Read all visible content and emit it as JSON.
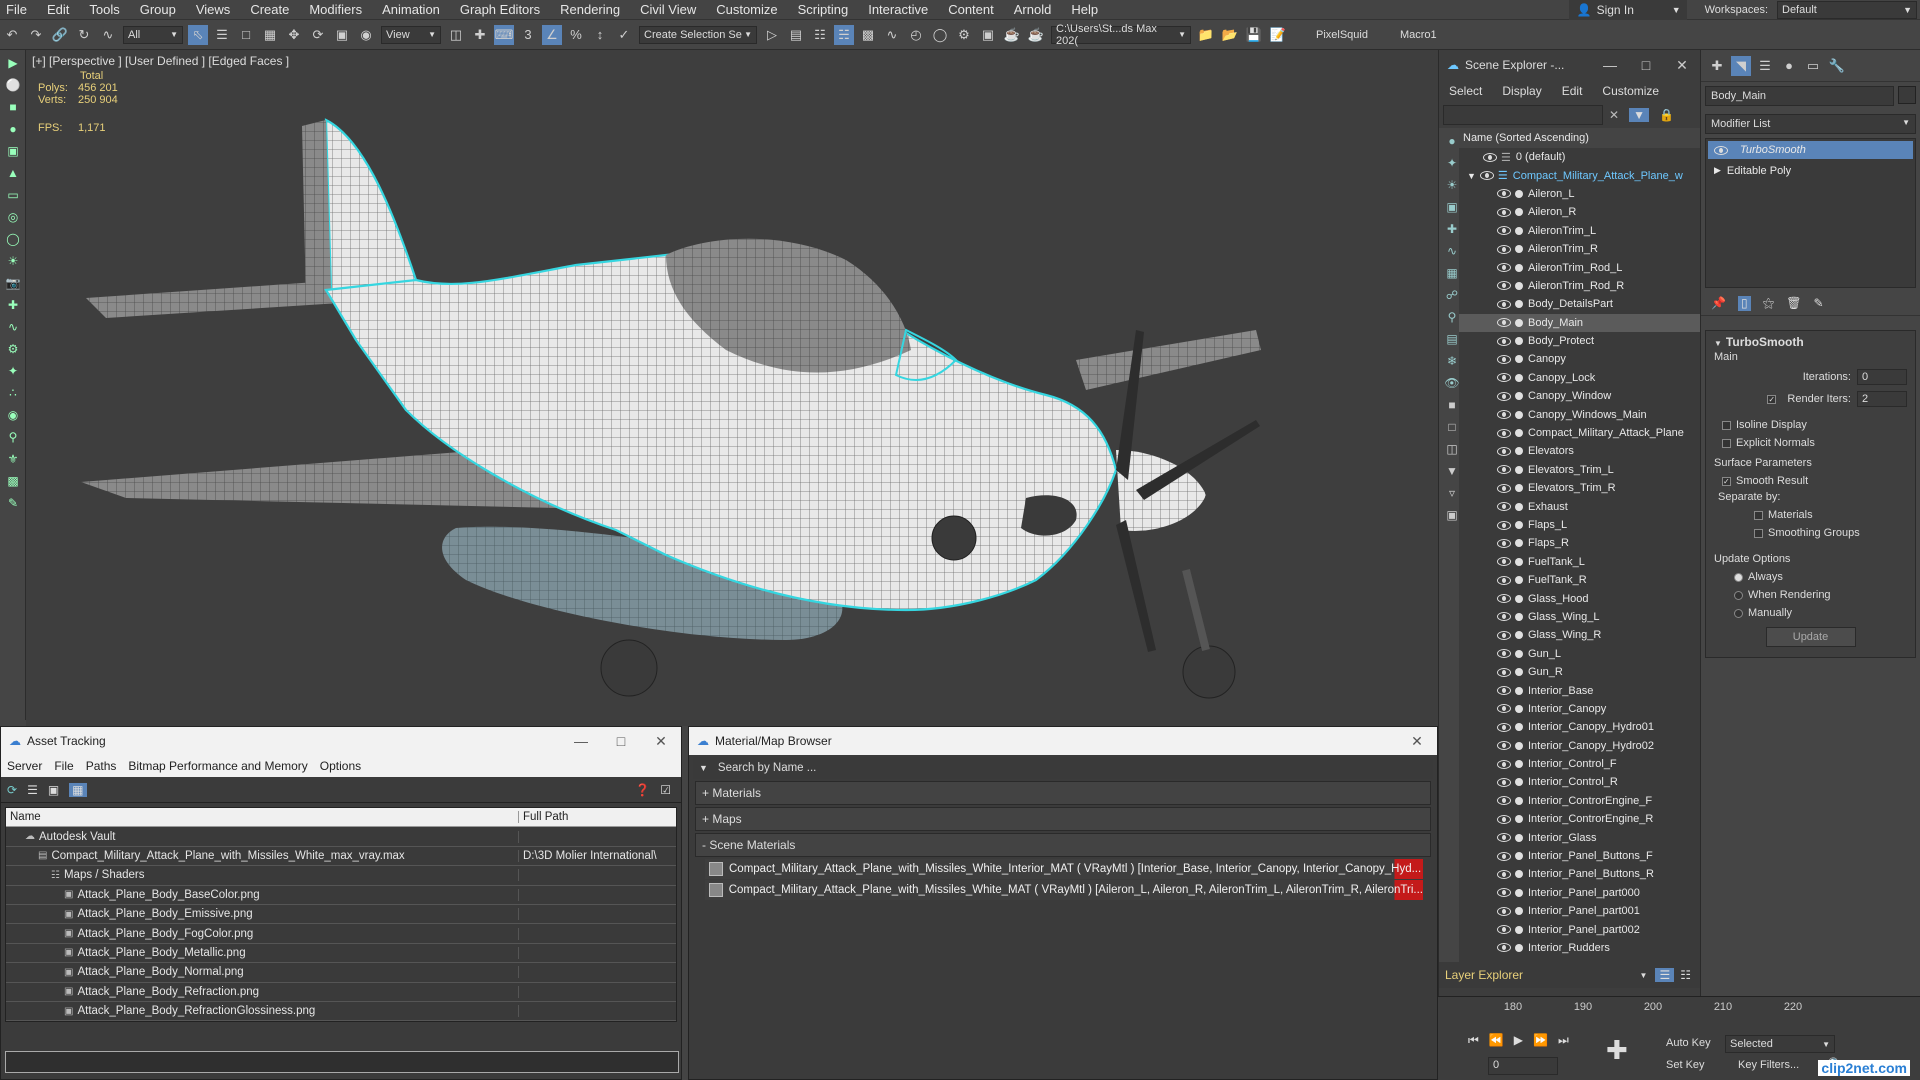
{
  "menu": [
    "File",
    "Edit",
    "Tools",
    "Group",
    "Views",
    "Create",
    "Modifiers",
    "Animation",
    "Graph Editors",
    "Rendering",
    "Civil View",
    "Customize",
    "Scripting",
    "Interactive",
    "Content",
    "Arnold",
    "Help"
  ],
  "menu_right": {
    "sign_in": "Sign In",
    "workspaces_label": "Workspaces:",
    "workspace_value": "Default"
  },
  "toolbar": {
    "filter": "All",
    "view": "View",
    "selection_set": "Create Selection Se",
    "path": "C:\\Users\\St...ds Max 202(",
    "pixelsquid": "PixelSquid",
    "macro": "Macro1"
  },
  "viewport": {
    "label": "[+] [Perspective ] [User Defined ] [Edged Faces ]",
    "stats": {
      "total": "Total",
      "polys_label": "Polys:",
      "polys": "456 201",
      "verts_label": "Verts:",
      "verts": "250 904",
      "fps_label": "FPS:",
      "fps": "1,171"
    }
  },
  "scene_explorer": {
    "title": "Scene Explorer -...",
    "tabs": [
      "Select",
      "Display",
      "Edit",
      "Customize"
    ],
    "header": "Name (Sorted Ascending)",
    "root_default": "0 (default)",
    "root_layer": "Compact_Military_Attack_Plane_w",
    "items": [
      "Aileron_L",
      "Aileron_R",
      "AileronTrim_L",
      "AileronTrim_R",
      "AileronTrim_Rod_L",
      "AileronTrim_Rod_R",
      "Body_DetailsPart",
      "Body_Main",
      "Body_Protect",
      "Canopy",
      "Canopy_Lock",
      "Canopy_Window",
      "Canopy_Windows_Main",
      "Compact_Military_Attack_Plane",
      "Elevators",
      "Elevators_Trim_L",
      "Elevators_Trim_R",
      "Exhaust",
      "Flaps_L",
      "Flaps_R",
      "FuelTank_L",
      "FuelTank_R",
      "Glass_Hood",
      "Glass_Wing_L",
      "Glass_Wing_R",
      "Gun_L",
      "Gun_R",
      "Interior_Base",
      "Interior_Canopy",
      "Interior_Canopy_Hydro01",
      "Interior_Canopy_Hydro02",
      "Interior_Control_F",
      "Interior_Control_R",
      "Interior_ControrEngine_F",
      "Interior_ControrEngine_R",
      "Interior_Glass",
      "Interior_Panel_Buttons_F",
      "Interior_Panel_Buttons_R",
      "Interior_Panel_part000",
      "Interior_Panel_part001",
      "Interior_Panel_part002",
      "Interior_Rudders"
    ],
    "selected_item": "Body_Main",
    "footer": "Layer Explorer"
  },
  "command_panel": {
    "object_name": "Body_Main",
    "modifier_list": "Modifier List",
    "stack": [
      "TurboSmooth",
      "Editable Poly"
    ],
    "rollout_title": "TurboSmooth",
    "main": "Main",
    "iterations_label": "Iterations:",
    "iterations": "0",
    "render_iters_label": "Render Iters:",
    "render_iters": "2",
    "isoline": "Isoline Display",
    "explicit": "Explicit Normals",
    "surface": "Surface Parameters",
    "smooth_result": "Smooth Result",
    "separate": "Separate by:",
    "materials": "Materials",
    "smoothing_groups": "Smoothing Groups",
    "update_options": "Update Options",
    "always": "Always",
    "when_rendering": "When Rendering",
    "manually": "Manually",
    "update_btn": "Update"
  },
  "timeline": {
    "ticks": [
      "180",
      "190",
      "200",
      "210",
      "220"
    ],
    "auto_key": "Auto Key",
    "set_key": "Set Key",
    "selected": "Selected",
    "key_filters": "Key Filters...",
    "frame": "0"
  },
  "asset_tracking": {
    "title": "Asset Tracking",
    "menu": [
      "Server",
      "File",
      "Paths",
      "Bitmap Performance and Memory",
      "Options"
    ],
    "col_name": "Name",
    "col_path": "Full Path",
    "rows": [
      {
        "name": "Autodesk Vault",
        "path": "",
        "indent": 1
      },
      {
        "name": "Compact_Military_Attack_Plane_with_Missiles_White_max_vray.max",
        "path": "D:\\3D Molier International\\",
        "indent": 2
      },
      {
        "name": "Maps / Shaders",
        "path": "",
        "indent": 3
      },
      {
        "name": "Attack_Plane_Body_BaseColor.png",
        "path": "",
        "indent": 4
      },
      {
        "name": "Attack_Plane_Body_Emissive.png",
        "path": "",
        "indent": 4
      },
      {
        "name": "Attack_Plane_Body_FogColor.png",
        "path": "",
        "indent": 4
      },
      {
        "name": "Attack_Plane_Body_Metallic.png",
        "path": "",
        "indent": 4
      },
      {
        "name": "Attack_Plane_Body_Normal.png",
        "path": "",
        "indent": 4
      },
      {
        "name": "Attack_Plane_Body_Refraction.png",
        "path": "",
        "indent": 4
      },
      {
        "name": "Attack_Plane_Body_RefractionGlossiness.png",
        "path": "",
        "indent": 4
      }
    ]
  },
  "material_browser": {
    "title": "Material/Map Browser",
    "search": "Search by Name ...",
    "groups": [
      "+ Materials",
      "+ Maps",
      "- Scene Materials"
    ],
    "scene_materials": [
      "Compact_Military_Attack_Plane_with_Missiles_White_Interior_MAT ( VRayMtl ) [Interior_Base, Interior_Canopy, Interior_Canopy_Hyd...",
      "Compact_Military_Attack_Plane_with_Missiles_White_MAT ( VRayMtl ) [Aileron_L, Aileron_R, AileronTrim_L, AileronTrim_R, AileronTri..."
    ]
  },
  "watermark": "clip2net.com"
}
